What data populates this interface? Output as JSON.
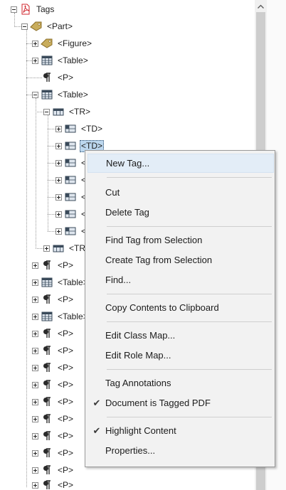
{
  "tree": {
    "root_label": "Tags",
    "part_label": "<Part>",
    "figure_label": "<Figure>",
    "table1_label": "<Table>",
    "p1_label": "<P>",
    "table2_label": "<Table>",
    "tr_label": "<TR>",
    "td_labels": [
      "<TD>",
      "<TD>",
      "<",
      "<",
      "<",
      "<",
      "<"
    ],
    "tr2_label": "<TR",
    "tail_labels": [
      "<P>",
      "<Table>",
      "<P>",
      "<Table>",
      "<P>",
      "<P>",
      "<P>",
      "<P>",
      "<P>",
      "<P>",
      "<P>",
      "<P>",
      "<P>",
      "<P>"
    ]
  },
  "menu": {
    "items": [
      {
        "label": "New Tag...",
        "checked": false
      },
      {
        "label": "Cut",
        "checked": false
      },
      {
        "label": "Delete Tag",
        "checked": false
      },
      {
        "label": "Find Tag from Selection",
        "checked": false
      },
      {
        "label": "Create Tag from Selection",
        "checked": false
      },
      {
        "label": "Find...",
        "checked": false
      },
      {
        "label": "Copy Contents to Clipboard",
        "checked": false
      },
      {
        "label": "Edit Class Map...",
        "checked": false
      },
      {
        "label": "Edit Role Map...",
        "checked": false
      },
      {
        "label": "Tag Annotations",
        "checked": false
      },
      {
        "label": "Document is Tagged PDF",
        "checked": true
      },
      {
        "label": "Highlight Content",
        "checked": true
      },
      {
        "label": "Properties...",
        "checked": false
      }
    ],
    "check_glyph": "✔"
  },
  "icons": {
    "pdf": "pdf-tag-icon",
    "tag": "tag-icon",
    "table": "table-icon",
    "row": "table-row-icon",
    "cell": "table-cell-icon",
    "para": "paragraph-icon"
  },
  "colors": {
    "selection": "#bcd7ee",
    "menu_bg": "#f2f2f2",
    "menu_highlight": "#e3edf7",
    "pdf_red": "#d0262d",
    "tag_gold": "#b89a48"
  }
}
